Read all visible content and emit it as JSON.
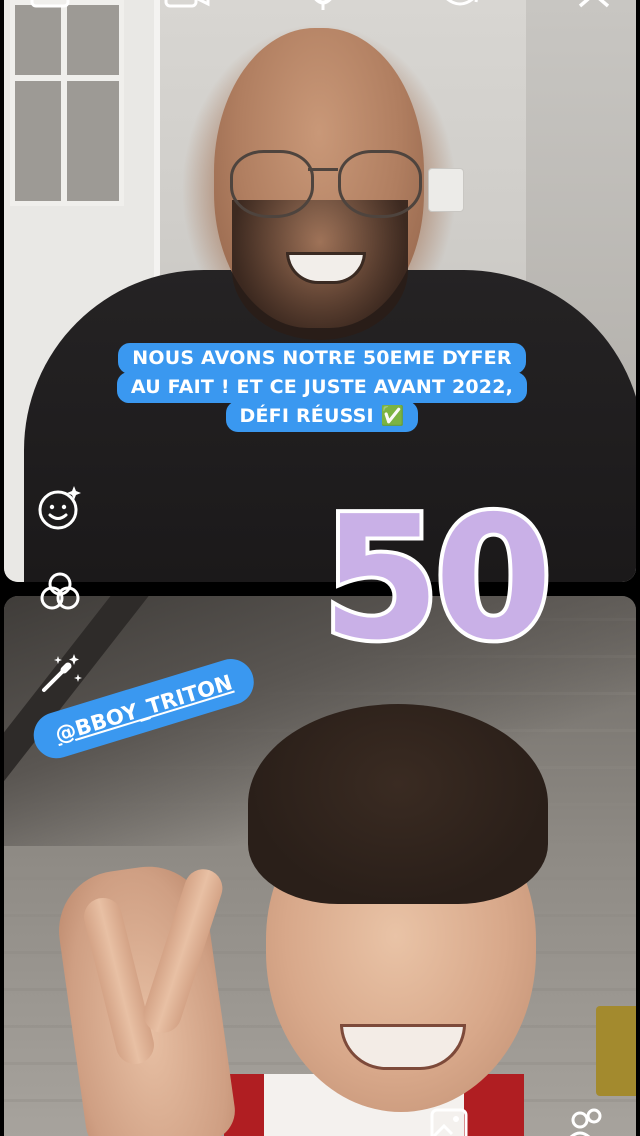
{
  "top_bar": {
    "icons": [
      "window-icon",
      "video-camera-icon",
      "microphone-icon",
      "switch-camera-icon",
      "close-icon"
    ]
  },
  "caption": {
    "lines": [
      "NOUS AVONS NOTRE 50EME DYFER",
      "AU FAIT ! ET CE JUSTE AVANT 2022,",
      "DÉFI RÉUSSI ✅"
    ],
    "color": "#3a98f0"
  },
  "sticker_number": {
    "text": "50",
    "fill_color": "#c9b0e7",
    "outline_color": "#ffffff"
  },
  "mention": {
    "text": "@BBOY_TRITON",
    "color": "#3a98f0"
  },
  "tools": {
    "icons": [
      "face-effects-icon",
      "filters-icon",
      "magic-wand-icon"
    ]
  },
  "bottom_bar": {
    "icons": [
      "gallery-icon",
      "participants-icon"
    ]
  }
}
